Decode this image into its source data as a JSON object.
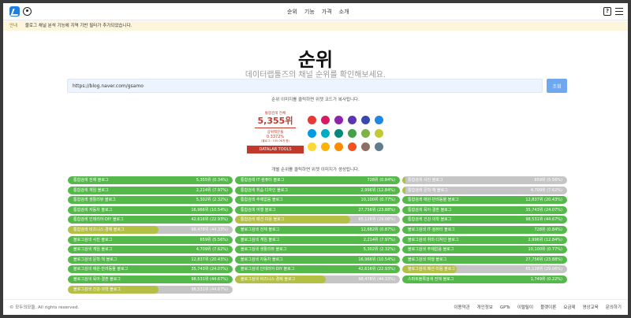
{
  "header": {
    "nav": [
      "순위",
      "기능",
      "가격",
      "소개"
    ],
    "help_label": "?"
  },
  "notice": {
    "tag": "안내",
    "text": "블로그 채널 분석 기능에 지역 기반 필터가 추가되었습니다."
  },
  "hero": {
    "title": "순위",
    "subtitle": "데이터랩툴즈의 채널 순위를 확인해보세요."
  },
  "search": {
    "value": "https://blog.naver.com/gsamo",
    "button": "조회"
  },
  "hints": {
    "image_copy": "순위 이미지를 클릭하면 위젯 코드가 복사됩니다.",
    "ranks_generate": "개별 순위를 클릭하면 위젯 이미지가 생성됩니다."
  },
  "preview": {
    "label": "통합검색 전체",
    "rank": "5,355위",
    "pct_label": "상위백분율",
    "pct": "0.3372%",
    "range": "(블로그 : 155.0K개 중)",
    "brand": "DATALAB TOOLS",
    "accent_color": "#c0392b"
  },
  "swatch_colors": [
    "#e53935",
    "#d81b60",
    "#8e24aa",
    "#5e35b1",
    "#3949ab",
    "#1e88e5",
    "#039be5",
    "#00acc1",
    "#00897b",
    "#43a047",
    "#7cb342",
    "#c0ca33",
    "#fdd835",
    "#ffb300",
    "#fb8c00",
    "#f4511e",
    "#8d6e63",
    "#607d8b"
  ],
  "rank_columns": [
    [
      {
        "name": "통합검색 전체 블로그",
        "value": "5,355위 (0.34%)",
        "fill": 1.0
      },
      {
        "name": "통합검색 게임 블로그",
        "value": "2,214위 (7.97%)",
        "fill": 1.0
      },
      {
        "name": "통합검색 생활리뷰 블로그",
        "value": "5,302위 (2.32%)",
        "fill": 1.0
      },
      {
        "name": "통합검색 자동차 블로그",
        "value": "16,966위 (10.54%)",
        "fill": 1.0
      },
      {
        "name": "통합검색 인테리어·DIY 블로그",
        "value": "42,616위 (22.93%)",
        "fill": 1.0
      },
      {
        "name": "통합검색 비즈니스·경제 블로그",
        "value": "98,478위 (44.33%)",
        "fill": 0.55
      },
      {
        "name": "블로그검색 사진 블로그",
        "value": "659위 (5.56%)",
        "fill": 1.0
      },
      {
        "name": "블로그검색 게임 블로그",
        "value": "4,709위 (7.62%)",
        "fill": 1.0
      },
      {
        "name": "블로그검색 문학·책 블로그",
        "value": "12,837위 (20.43%)",
        "fill": 1.0
      },
      {
        "name": "블로그검색 애완·반려동물 블로그",
        "value": "35,743위 (24.07%)",
        "fill": 1.0
      },
      {
        "name": "블로그검색 육아·결혼 블로그",
        "value": "98,531위 (44.67%)",
        "fill": 1.0
      },
      {
        "name": "블로그검색 건강·의학 블로그",
        "value": "98,531위 (44.67%)",
        "fill": 0.55
      }
    ],
    [
      {
        "name": "통합검색 IT·컴퓨터 블로그",
        "value": "728위 (0.84%)",
        "fill": 1.0
      },
      {
        "name": "통합검색 취솜·디자인 블로그",
        "value": "2,996위 (12.84%)",
        "fill": 1.0
      },
      {
        "name": "통합검색 주제없음 블로그",
        "value": "10,100위 (0.77%)",
        "fill": 1.0
      },
      {
        "name": "통합검색 여행 블로그",
        "value": "27,756위 (23.88%)",
        "fill": 1.0
      },
      {
        "name": "통합검색 패션·미용 블로그",
        "value": "65,128위 (29.06%)",
        "fill": 0.7
      },
      {
        "name": "블로그검색 전체 블로그",
        "value": "12,682위 (0.87%)",
        "fill": 1.0
      },
      {
        "name": "블로그검색 게임 블로그",
        "value": "2,214위 (7.97%)",
        "fill": 1.0
      },
      {
        "name": "블로그검색 생활리뷰 블로그",
        "value": "5,302위 (2.32%)",
        "fill": 1.0
      },
      {
        "name": "블로그검색 자동차 블로그",
        "value": "16,966위 (10.54%)",
        "fill": 1.0
      },
      {
        "name": "블로그검색 인테리어·DIY 블로그",
        "value": "42,616위 (22.93%)",
        "fill": 1.0
      },
      {
        "name": "블로그검색 비즈니스·경제 블로그",
        "value": "98,478위 (44.33%)",
        "fill": 0.55
      }
    ],
    [
      {
        "name": "통합검색 사진 블로그",
        "value": "659위 (5.56%)",
        "fill": 0.02
      },
      {
        "name": "통합검색 문학·책 블로그",
        "value": "4,709위 (7.62%)",
        "fill": 0.02
      },
      {
        "name": "통합검색 애완·반려동물 블로그",
        "value": "12,837위 (20.43%)",
        "fill": 1.0
      },
      {
        "name": "통합검색 육아·결혼 블로그",
        "value": "35,743위 (24.07%)",
        "fill": 1.0
      },
      {
        "name": "통합검색 건강·의학 블로그",
        "value": "98,531위 (44.67%)",
        "fill": 1.0
      },
      {
        "name": "블로그검색 IT·컴퓨터 블로그",
        "value": "728위 (0.84%)",
        "fill": 1.0
      },
      {
        "name": "블로그검색 취미·디자인 블로그",
        "value": "2,996위 (12.84%)",
        "fill": 1.0
      },
      {
        "name": "블로그검색 주제없음 블로그",
        "value": "10,100위 (0.77%)",
        "fill": 1.0
      },
      {
        "name": "블로그검색 여행 블로그",
        "value": "27,756위 (23.88%)",
        "fill": 1.0
      },
      {
        "name": "블로그검색 패션·미용 블로그",
        "value": "65,128위 (29.06%)",
        "fill": 0.33
      },
      {
        "name": "스마트블록검색 전체 블로그",
        "value": "1,749위 (0.22%)",
        "fill": 1.0
      }
    ]
  ],
  "footer": {
    "copyright": "© 모두의모들. All rights reserved.",
    "links": [
      "이용약관",
      "개인정보",
      "GPTs",
      "이럴릴이",
      "플랫이론",
      "요금제",
      "영상교육",
      "문의하기"
    ]
  }
}
